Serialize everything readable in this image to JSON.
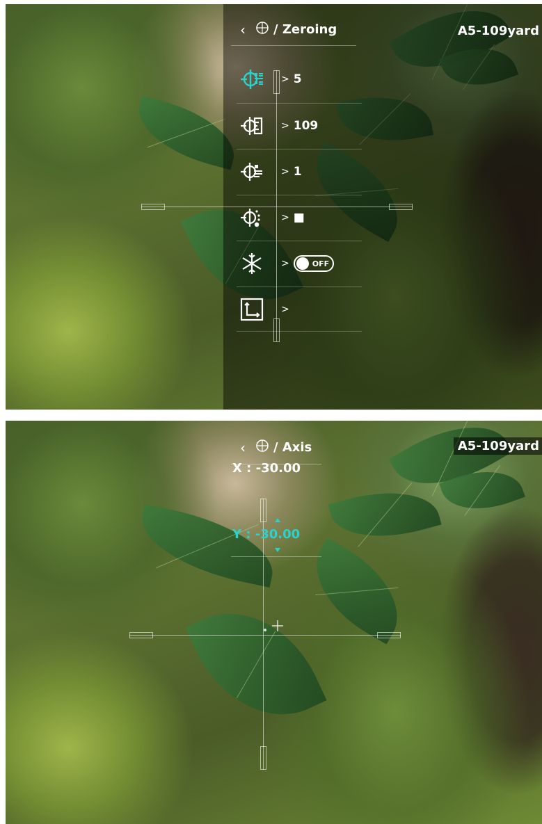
{
  "screen1": {
    "breadcrumb": {
      "back_icon": "‹",
      "icon": "crosshair-circle-icon",
      "title": "/ Zeroing"
    },
    "model": "A5-109yard",
    "menu": [
      {
        "icon": "zeroing-profile-icon",
        "value": "5",
        "arrow": ">"
      },
      {
        "icon": "zeroing-distance-icon",
        "value": "109",
        "arrow": ">"
      },
      {
        "icon": "reticle-style-icon",
        "value": "1",
        "arrow": ">"
      },
      {
        "icon": "reticle-color-icon",
        "value": "■",
        "arrow": ">"
      },
      {
        "icon": "freeze-icon",
        "value": "OFF",
        "arrow": ">"
      },
      {
        "icon": "axis-adjust-icon",
        "value": "",
        "arrow": ">"
      }
    ],
    "highlight_color": "#29d3cc"
  },
  "screen2": {
    "breadcrumb": {
      "back_icon": "‹",
      "icon": "crosshair-circle-icon",
      "title": "/ Axis"
    },
    "model": "A5-109yard",
    "x_label": "X : -30.00",
    "y_label": "Y : -30.00",
    "active_color": "#29d3cc"
  }
}
